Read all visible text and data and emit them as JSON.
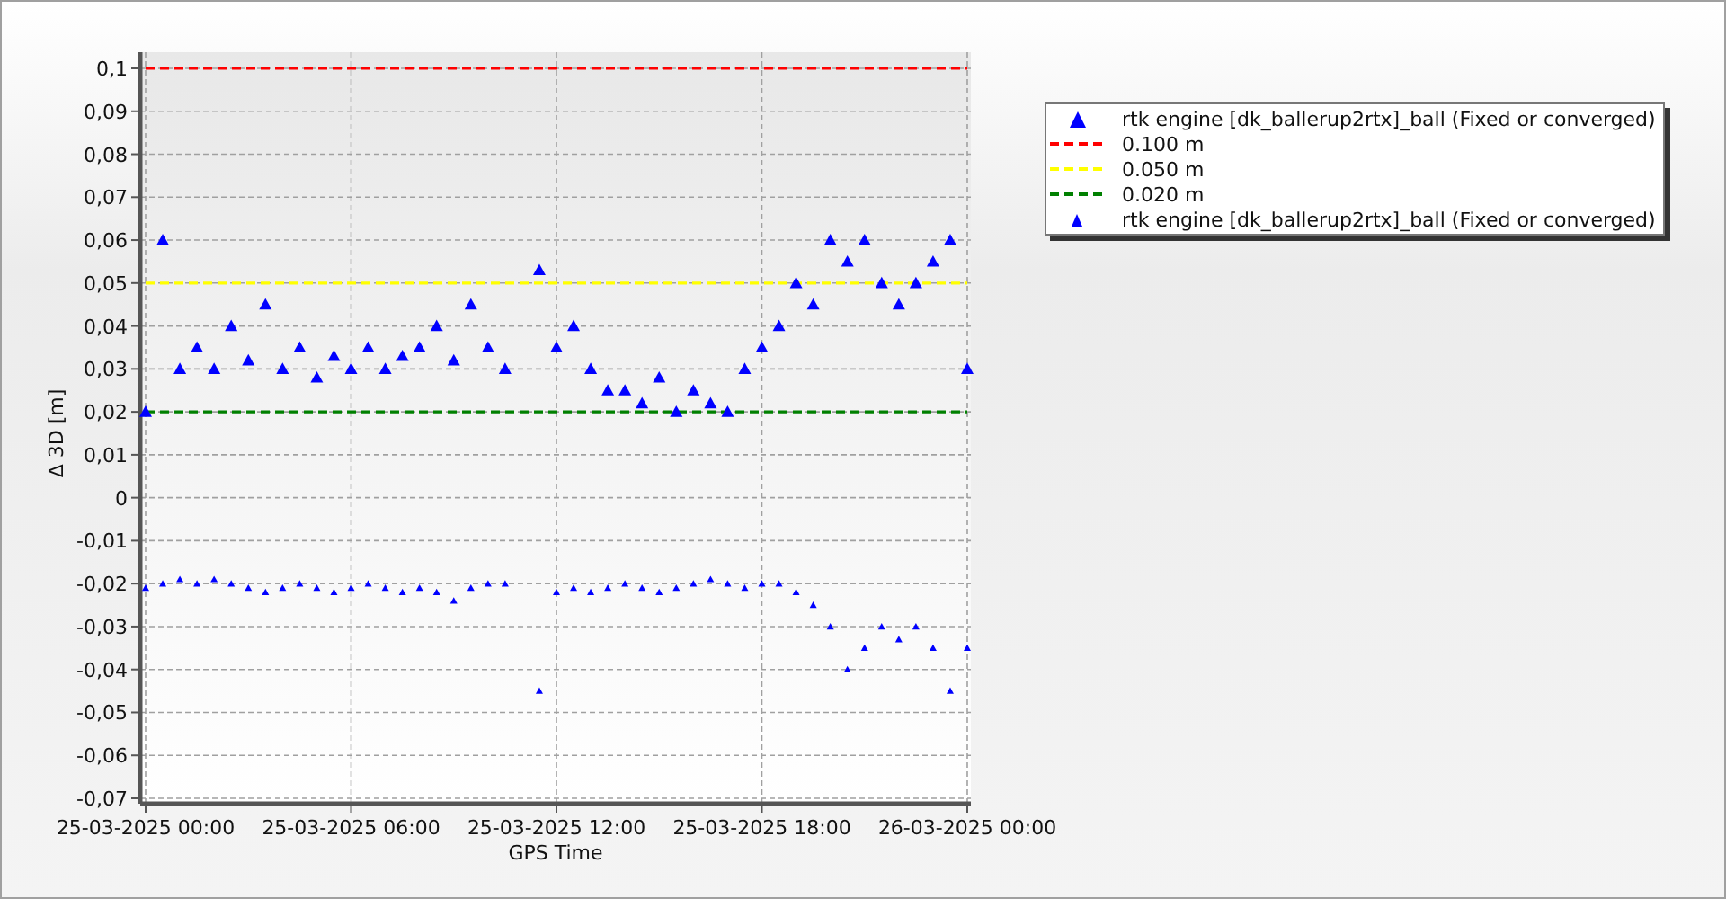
{
  "chart": {
    "chart_data": {
      "type": "scatter",
      "xlabel": "GPS Time",
      "ylabel": "Δ 3D [m]",
      "categories": [
        "25-03-2025 00:00",
        null,
        null,
        null,
        null,
        null,
        null,
        null,
        null,
        null,
        null,
        null,
        "25-03-2025 06:00",
        null,
        null,
        null,
        null,
        null,
        null,
        null,
        null,
        null,
        null,
        null,
        "25-03-2025 12:00",
        null,
        null,
        null,
        null,
        null,
        null,
        null,
        null,
        null,
        null,
        null,
        "25-03-2025 18:00",
        null,
        null,
        null,
        null,
        null,
        null,
        null,
        null,
        null,
        null,
        null,
        "26-03-2025 00:00"
      ],
      "ylim": [
        -0.07,
        0.1
      ],
      "yticks": [
        {
          "value": 0.1,
          "label": "0,1"
        },
        {
          "value": 0.09,
          "label": "0,09"
        },
        {
          "value": 0.08,
          "label": "0,08"
        },
        {
          "value": 0.07,
          "label": "0,07"
        },
        {
          "value": 0.06,
          "label": "0,06"
        },
        {
          "value": 0.05,
          "label": "0,05"
        },
        {
          "value": 0.04,
          "label": "0,04"
        },
        {
          "value": 0.03,
          "label": "0,03"
        },
        {
          "value": 0.02,
          "label": "0,02"
        },
        {
          "value": 0.01,
          "label": "0,01"
        },
        {
          "value": 0,
          "label": "0"
        },
        {
          "value": -0.01,
          "label": "-0,01"
        },
        {
          "value": -0.02,
          "label": "-0,02"
        },
        {
          "value": -0.03,
          "label": "-0,03"
        },
        {
          "value": -0.04,
          "label": "-0,04"
        },
        {
          "value": -0.05,
          "label": "-0,05"
        },
        {
          "value": -0.06,
          "label": "-0,06"
        },
        {
          "value": -0.07,
          "label": "-0,07"
        }
      ],
      "series": [
        {
          "name": "rtk engine [dk_ballerup2rtx]_ball (Fixed or converged)",
          "type": "scatter",
          "color": "#0000ff",
          "values": [
            0.02,
            0.06,
            0.03,
            0.035,
            0.03,
            0.04,
            0.032,
            0.045,
            0.03,
            0.035,
            0.028,
            0.033,
            0.03,
            0.035,
            0.03,
            0.033,
            0.035,
            0.04,
            0.032,
            0.045,
            0.035,
            0.03,
            null,
            0.053,
            0.035,
            0.04,
            0.03,
            0.025,
            0.025,
            0.022,
            0.028,
            0.02,
            0.025,
            0.022,
            0.02,
            0.03,
            0.035,
            0.04,
            0.05,
            0.045,
            0.06,
            0.055,
            0.06,
            0.05,
            0.045,
            0.05,
            0.055,
            0.06,
            0.03
          ]
        },
        {
          "name": "0.100 m",
          "type": "line",
          "line_style": "dashed",
          "color": "#ff0000",
          "values": [
            0.1,
            0.1,
            0.1,
            0.1,
            0.1,
            0.1,
            0.1,
            0.1,
            0.1,
            0.1,
            0.1,
            0.1,
            0.1,
            0.1,
            0.1,
            0.1,
            0.1,
            0.1,
            0.1,
            0.1,
            0.1,
            0.1,
            0.1,
            0.1,
            0.1,
            0.1,
            0.1,
            0.1,
            0.1,
            0.1,
            0.1,
            0.1,
            0.1,
            0.1,
            0.1,
            0.1,
            0.1,
            0.1,
            0.1,
            0.1,
            0.1,
            0.1,
            0.1,
            0.1,
            0.1,
            0.1,
            0.1,
            0.1,
            0.1
          ]
        },
        {
          "name": "0.050 m",
          "type": "line",
          "line_style": "dashed",
          "color": "#ffff00",
          "values": [
            0.05,
            0.05,
            0.05,
            0.05,
            0.05,
            0.05,
            0.05,
            0.05,
            0.05,
            0.05,
            0.05,
            0.05,
            0.05,
            0.05,
            0.05,
            0.05,
            0.05,
            0.05,
            0.05,
            0.05,
            0.05,
            0.05,
            0.05,
            0.05,
            0.05,
            0.05,
            0.05,
            0.05,
            0.05,
            0.05,
            0.05,
            0.05,
            0.05,
            0.05,
            0.05,
            0.05,
            0.05,
            0.05,
            0.05,
            0.05,
            0.05,
            0.05,
            0.05,
            0.05,
            0.05,
            0.05,
            0.05,
            0.05,
            0.05
          ]
        },
        {
          "name": "0.020 m",
          "type": "line",
          "line_style": "dashed",
          "color": "#008000",
          "values": [
            0.02,
            0.02,
            0.02,
            0.02,
            0.02,
            0.02,
            0.02,
            0.02,
            0.02,
            0.02,
            0.02,
            0.02,
            0.02,
            0.02,
            0.02,
            0.02,
            0.02,
            0.02,
            0.02,
            0.02,
            0.02,
            0.02,
            0.02,
            0.02,
            0.02,
            0.02,
            0.02,
            0.02,
            0.02,
            0.02,
            0.02,
            0.02,
            0.02,
            0.02,
            0.02,
            0.02,
            0.02,
            0.02,
            0.02,
            0.02,
            0.02,
            0.02,
            0.02,
            0.02,
            0.02,
            0.02,
            0.02,
            0.02,
            0.02
          ]
        },
        {
          "name": "rtk engine [dk_ballerup2rtx]_ball (Fixed or converged)",
          "type": "scatter",
          "color": "#0000ff",
          "values": [
            -0.021,
            -0.02,
            -0.019,
            -0.02,
            -0.019,
            -0.02,
            -0.021,
            -0.022,
            -0.021,
            -0.02,
            -0.021,
            -0.022,
            -0.021,
            -0.02,
            -0.021,
            -0.022,
            -0.021,
            -0.022,
            -0.024,
            -0.021,
            -0.02,
            -0.02,
            null,
            -0.045,
            -0.022,
            -0.021,
            -0.022,
            -0.021,
            -0.02,
            -0.021,
            -0.022,
            -0.021,
            -0.02,
            -0.019,
            -0.02,
            -0.021,
            -0.02,
            -0.02,
            -0.022,
            -0.025,
            -0.03,
            -0.04,
            -0.035,
            -0.03,
            -0.033,
            -0.03,
            -0.035,
            -0.045,
            -0.035
          ]
        }
      ],
      "grid": true
    }
  }
}
